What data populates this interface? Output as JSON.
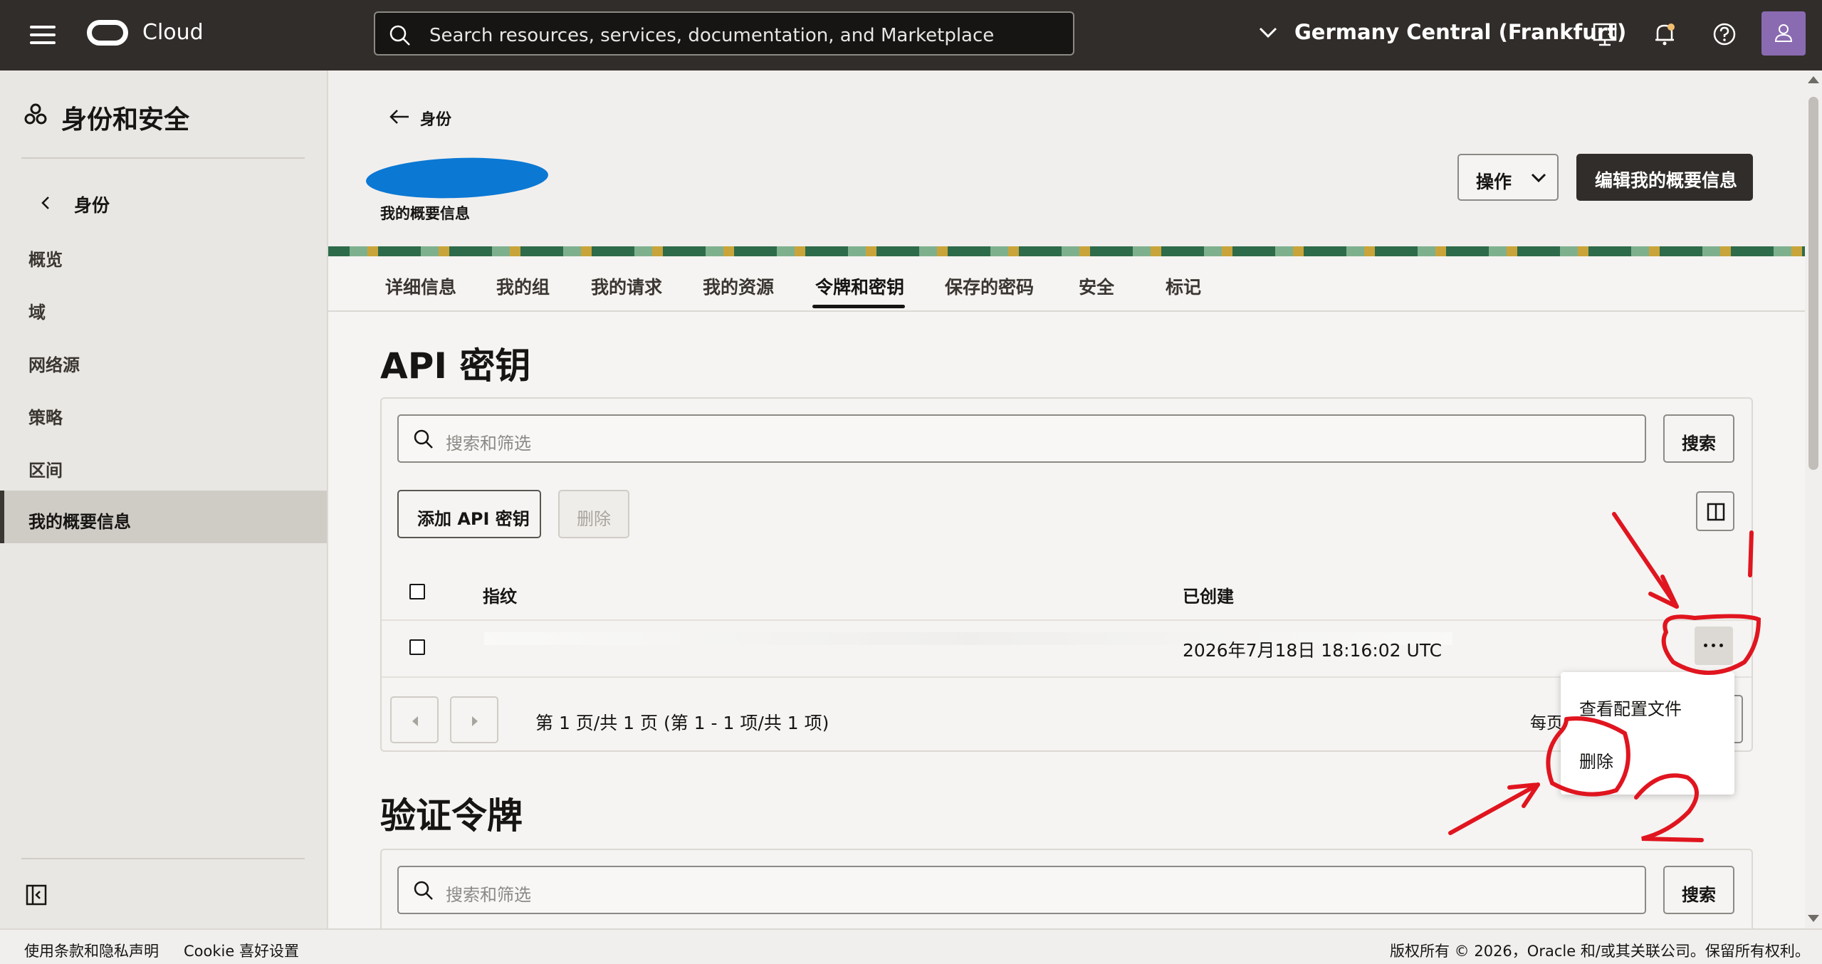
{
  "topbar": {
    "brand": "Cloud",
    "search_placeholder": "Search resources, services, documentation, and Marketplace",
    "region": "Germany Central (Frankfurt)",
    "icons": [
      "menu-icon",
      "oracle-logo-icon",
      "search-icon",
      "chevron-down-icon",
      "developer-tools-icon",
      "bell-icon",
      "help-icon",
      "user-icon"
    ]
  },
  "sidebar": {
    "title": "身份和安全",
    "back_label": "身份",
    "items": [
      {
        "label": "概览"
      },
      {
        "label": "域"
      },
      {
        "label": "网络源"
      },
      {
        "label": "策略"
      },
      {
        "label": "区间"
      },
      {
        "label": "我的概要信息",
        "active": true
      }
    ]
  },
  "header": {
    "back_label": "身份",
    "subtitle": "我的概要信息",
    "actions_label": "操作",
    "edit_label": "编辑我的概要信息"
  },
  "tabs": [
    {
      "label": "详细信息"
    },
    {
      "label": "我的组"
    },
    {
      "label": "我的请求"
    },
    {
      "label": "我的资源"
    },
    {
      "label": "令牌和密钥",
      "active": true
    },
    {
      "label": "保存的密码"
    },
    {
      "label": "安全"
    },
    {
      "label": "标记"
    }
  ],
  "api_keys": {
    "title": "API 密钥",
    "search_placeholder": "搜索和筛选",
    "search_button": "搜索",
    "add_button": "添加 API 密钥",
    "delete_button": "删除",
    "columns": [
      "指纹",
      "已创建"
    ],
    "rows": [
      {
        "fingerprint": "",
        "created": "2026年7月18日 18:16:02 UTC"
      }
    ],
    "pagination": "第 1 页/共 1 页 (第 1 - 1 项/共 1 项)",
    "per_page_label": "每页"
  },
  "row_menu": {
    "items": [
      "查看配置文件",
      "删除"
    ]
  },
  "auth_tokens": {
    "title": "验证令牌",
    "search_placeholder": "搜索和筛选",
    "search_button": "搜索"
  },
  "footer": {
    "terms": "使用条款和隐私声明",
    "cookies": "Cookie 喜好设置",
    "copyright": "版权所有 © 2026，Oracle 和/或其关联公司。保留所有权利。"
  },
  "colors": {
    "topbar": "#312d2a",
    "primary_button": "#312d2a",
    "annotation_red": "#e0151f",
    "redaction_blue": "#0b78d4"
  }
}
